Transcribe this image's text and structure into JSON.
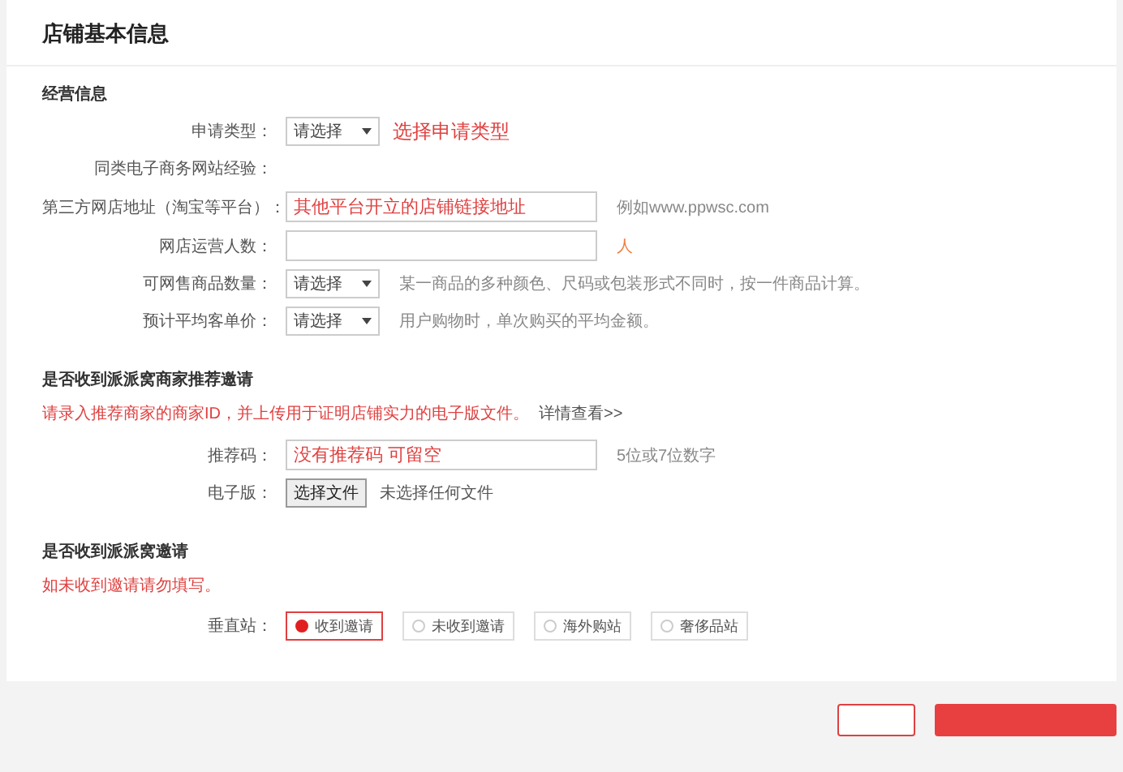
{
  "page": {
    "title": "店铺基本信息"
  },
  "sections": [
    {
      "title": "经营信息",
      "fields": [
        {
          "kind": "select",
          "label": "申请类型：",
          "value": "请选择",
          "annotation": "选择申请类型"
        },
        {
          "kind": "label_only",
          "label": "同类电子商务网站经验："
        },
        {
          "kind": "input",
          "label": "第三方网店地址（淘宝等平台）：",
          "value": "其他平台开立的店铺链接地址",
          "hint": "例如www.ppwsc.com"
        },
        {
          "kind": "input",
          "label": "网店运营人数：",
          "unit": "人"
        },
        {
          "kind": "select",
          "label": "可网售商品数量：",
          "value": "请选择",
          "hint": "某一商品的多种颜色、尺码或包装形式不同时，按一件商品计算。"
        },
        {
          "kind": "select",
          "label": "预计平均客单价：",
          "value": "请选择",
          "hint": "用户购物时，单次购买的平均金额。"
        }
      ]
    },
    {
      "title": "是否收到派派窝商家推荐邀请",
      "note": "请录入推荐商家的商家ID，并上传用于证明店铺实力的电子版文件。",
      "link": "详情查看>>",
      "fields": [
        {
          "kind": "input",
          "label": "推荐码：",
          "value": "没有推荐码 可留空",
          "hint": "5位或7位数字"
        },
        {
          "kind": "file",
          "label": "电子版：",
          "button": "选择文件",
          "status": "未选择任何文件"
        }
      ]
    },
    {
      "title": "是否收到派派窝邀请",
      "note": "如未收到邀请请勿填写。",
      "fields": [
        {
          "kind": "radio_group",
          "label": "垂直站：",
          "options": [
            {
              "label": "收到邀请",
              "selected": true
            },
            {
              "label": "未收到邀请",
              "selected": false
            },
            {
              "label": "海外购站",
              "selected": false
            },
            {
              "label": "奢侈品站",
              "selected": false
            }
          ]
        }
      ]
    }
  ],
  "buttons": [
    {
      "kind": "outline"
    },
    {
      "kind": "primary"
    }
  ]
}
